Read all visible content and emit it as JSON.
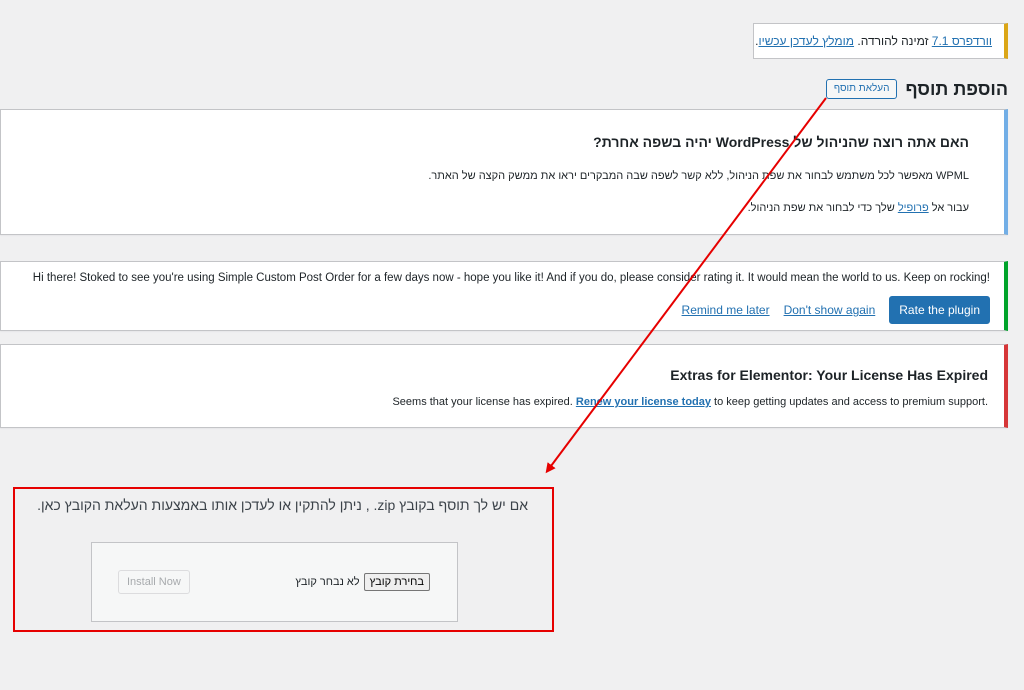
{
  "update_nag": {
    "version_link": "וורדפרס 7.1",
    "available_text": " זמינה להורדה. ",
    "update_link": "מומלץ לעדכן עכשיו",
    "suffix": "."
  },
  "header": {
    "title": "הוספת תוסף",
    "upload_button": "העלאת תוסף"
  },
  "wpml_notice": {
    "title": "האם אתה רוצה שהניהול של WordPress יהיה בשפה אחרת?",
    "body": "WPML מאפשר לכל משתמש לבחור את שפת הניהול, ללא קשר לשפה שבה המבקרים יראו את ממשק הקצה של האתר.",
    "profile_prefix": "עבור אל ",
    "profile_link": "פרופיל",
    "profile_suffix": " שלך כדי לבחור את שפת הניהול."
  },
  "scpo_notice": {
    "message": "Hi there! Stoked to see you're using Simple Custom Post Order for a few days now - hope you like it! And if you do, please consider rating it. It would mean the world to us. Keep on rocking!",
    "rate_button": "Rate the plugin",
    "dont_show": "Don't show again",
    "remind_later": "Remind me later"
  },
  "elementor_notice": {
    "title": "Extras for Elementor: Your License Has Expired",
    "body_prefix": "Seems that your license has expired. ",
    "renew_link": "Renew your license today",
    "body_suffix": " to keep getting updates and access to premium support."
  },
  "upload": {
    "description": "אם יש לך תוסף בקובץ zip. , ניתן להתקין או לעדכן אותו באמצעות העלאת הקובץ כאן.",
    "choose_file": "בחירת קובץ",
    "no_file": "לא נבחר קובץ",
    "install_button": "Install Now"
  },
  "colors": {
    "accent_blue": "#2271b1",
    "warning_yellow": "#dba617",
    "success_green": "#00a32a",
    "error_red": "#d63638",
    "annotation_red": "#e60000"
  }
}
